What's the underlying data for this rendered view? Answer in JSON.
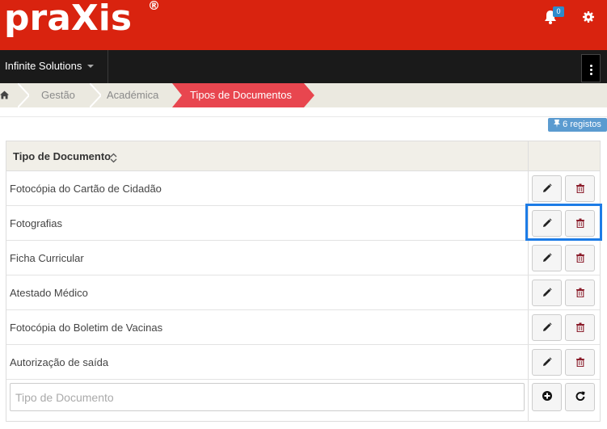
{
  "header": {
    "logo_text": "praXis",
    "logo_mark": "®",
    "notifications_count": "0",
    "icons": [
      "bell-icon",
      "gear-icon"
    ],
    "brand_color": "#d9230f"
  },
  "nav": {
    "organization": "Infinite Solutions",
    "icons": [
      "chevron-down-icon",
      "kebab-menu-icon"
    ]
  },
  "breadcrumb": {
    "items": [
      "Gestão",
      "Académica"
    ],
    "active": "Tipos de Documentos",
    "active_color": "#e8464f",
    "home_icon": "home-icon"
  },
  "records_badge": "6 registos",
  "table": {
    "column_header": "Tipo de Documento",
    "rows": [
      "Fotocópia do Cartão de Cidadão",
      "Fotografias",
      "Ficha Curricular",
      "Atestado Médico",
      "Fotocópia do Boletim de Vacinas",
      "Autorização de saída"
    ],
    "row_action_icons": [
      "pencil-icon",
      "trash-icon"
    ],
    "new_row": {
      "placeholder": "Tipo de Documento",
      "value": "",
      "action_icons": [
        "add-circle-icon",
        "refresh-icon"
      ]
    }
  }
}
